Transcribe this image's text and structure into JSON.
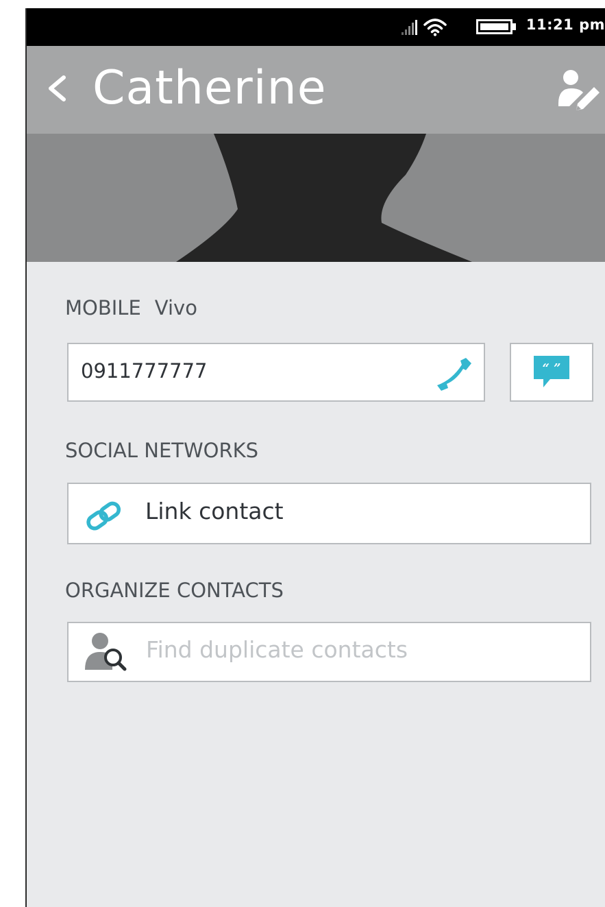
{
  "status_bar": {
    "time": "11:21 pm",
    "signal_icon": "signal-icon",
    "wifi_icon": "wifi-icon",
    "battery_icon": "battery-icon"
  },
  "header": {
    "title": "Catherine",
    "back_icon": "chevron-left-icon",
    "edit_icon": "edit-contact-icon",
    "background": "#a5a6a7"
  },
  "photo": {
    "icon": "contact-silhouette"
  },
  "mobile": {
    "label": "MOBILE",
    "carrier": "Vivo",
    "number": "0911777777",
    "call_icon": "phone-icon",
    "sms_icon": "message-icon",
    "accent": "#34b7cf"
  },
  "social": {
    "label": "SOCIAL NETWORKS",
    "link_label": "Link contact",
    "link_icon": "link-icon"
  },
  "organize": {
    "label": "ORGANIZE CONTACTS",
    "find_label": "Find duplicate contacts",
    "find_icon": "find-duplicate-icon"
  }
}
